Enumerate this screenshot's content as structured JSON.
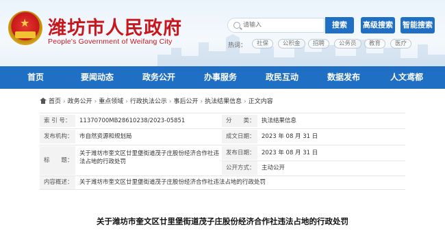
{
  "header": {
    "site_title": "潍坊市人民政府",
    "site_subtitle": "People's Government of Weifang City",
    "search_placeholder": "请输入",
    "search_button": "搜索",
    "advanced_search_button": "高级搜索",
    "smart_search_button": "智能搜索",
    "hot_label": "热词：",
    "hot_tags": [
      "社保",
      "公积金",
      "招聘",
      "公务员",
      "教育",
      "医疗"
    ]
  },
  "nav": {
    "items": [
      "首页",
      "要闻动态",
      "政务公开",
      "办事服务",
      "政民互动",
      "数据发布",
      "人文鸢都"
    ]
  },
  "breadcrumb": {
    "items": [
      "首页",
      "政务公开",
      "重点领域",
      "行政执法公示",
      "事后公开",
      "执法结果信息",
      "正文内容"
    ]
  },
  "info": {
    "index_label": "索 引 号：",
    "index_value": "11370700MB28610238/2023-05851",
    "category_label": "分　　类：",
    "category_value": "执法结果信息",
    "publisher_label": "发布机构：",
    "publisher_value": "市自然资源和规划局",
    "created_label": "成文日期：",
    "created_value": "2023 年 08 月 31 日",
    "title_label": "标　　题：",
    "title_value": "关于潍坊市奎文区廿里堡街道茂子庄股份经济合作社违法占地的行政处罚",
    "publish_label": "发布日期：",
    "publish_value": "2023 年 08 月 31 日",
    "mode_label": "公开方式：",
    "mode_value": "主动公开",
    "summary_label": "内容概述：",
    "summary_value": "关于潍坊市奎文区廿里堡街道茂子庄股份经济合作社违法占地的行政处罚"
  },
  "article": {
    "title": "关于潍坊市奎文区廿里堡街道茂子庄股份经济合作社违法占地的行政处罚"
  },
  "colors": {
    "brand_red": "#c8161d",
    "nav_blue": "#1f6fc5"
  }
}
